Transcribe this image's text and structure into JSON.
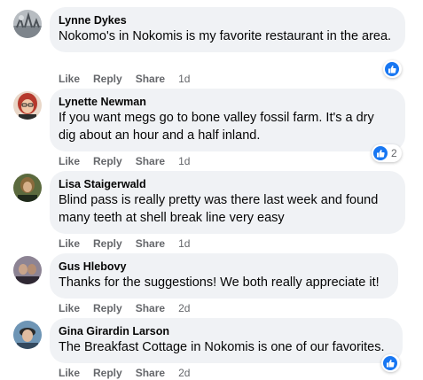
{
  "comments": [
    {
      "author": "Lynne Dykes",
      "text": "Nokomo's in Nokomis is my favorite restaurant in the area.",
      "actions": {
        "like": "Like",
        "reply": "Reply",
        "share": "Share",
        "time": "1d"
      },
      "reactions": {
        "icon": "like-icon",
        "count": ""
      },
      "avatar_colors": [
        "#9aa0a6",
        "#5f6368"
      ]
    },
    {
      "author": "Lynette Newman",
      "text": "If you want megs go to bone valley fossil farm. It's a dry dig about an hour and a half inland.",
      "actions": {
        "like": "Like",
        "reply": "Reply",
        "share": "Share",
        "time": "1d"
      },
      "reactions": {
        "icon": "like-icon",
        "count": "2"
      },
      "avatar_colors": [
        "#c84b3a",
        "#3b2a25"
      ]
    },
    {
      "author": "Lisa Staigerwald",
      "text": "Blind pass is really pretty was there last week and found many teeth at shell break line very easy",
      "actions": {
        "like": "Like",
        "reply": "Reply",
        "share": "Share",
        "time": "1d"
      },
      "avatar_colors": [
        "#7a6a3a",
        "#2e2a1f"
      ]
    },
    {
      "author": "Gus Hlebovy",
      "text": "Thanks for the suggestions! We both really appreciate it!",
      "actions": {
        "like": "Like",
        "reply": "Reply",
        "share": "Share",
        "time": "2d"
      },
      "avatar_colors": [
        "#6b5f72",
        "#2b2630"
      ]
    },
    {
      "author": "Gina Girardin Larson",
      "text": "The Breakfast Cottage in Nokomis is one of our favorites.",
      "actions": {
        "like": "Like",
        "reply": "Reply",
        "share": "Share",
        "time": "2d"
      },
      "reactions": {
        "icon": "like-icon",
        "count": ""
      },
      "avatar_colors": [
        "#4a7fa8",
        "#2d3a44"
      ]
    }
  ],
  "colors": {
    "bubble": "#f0f2f5",
    "action_text": "#65676b",
    "like_blue": "#1877f2"
  }
}
